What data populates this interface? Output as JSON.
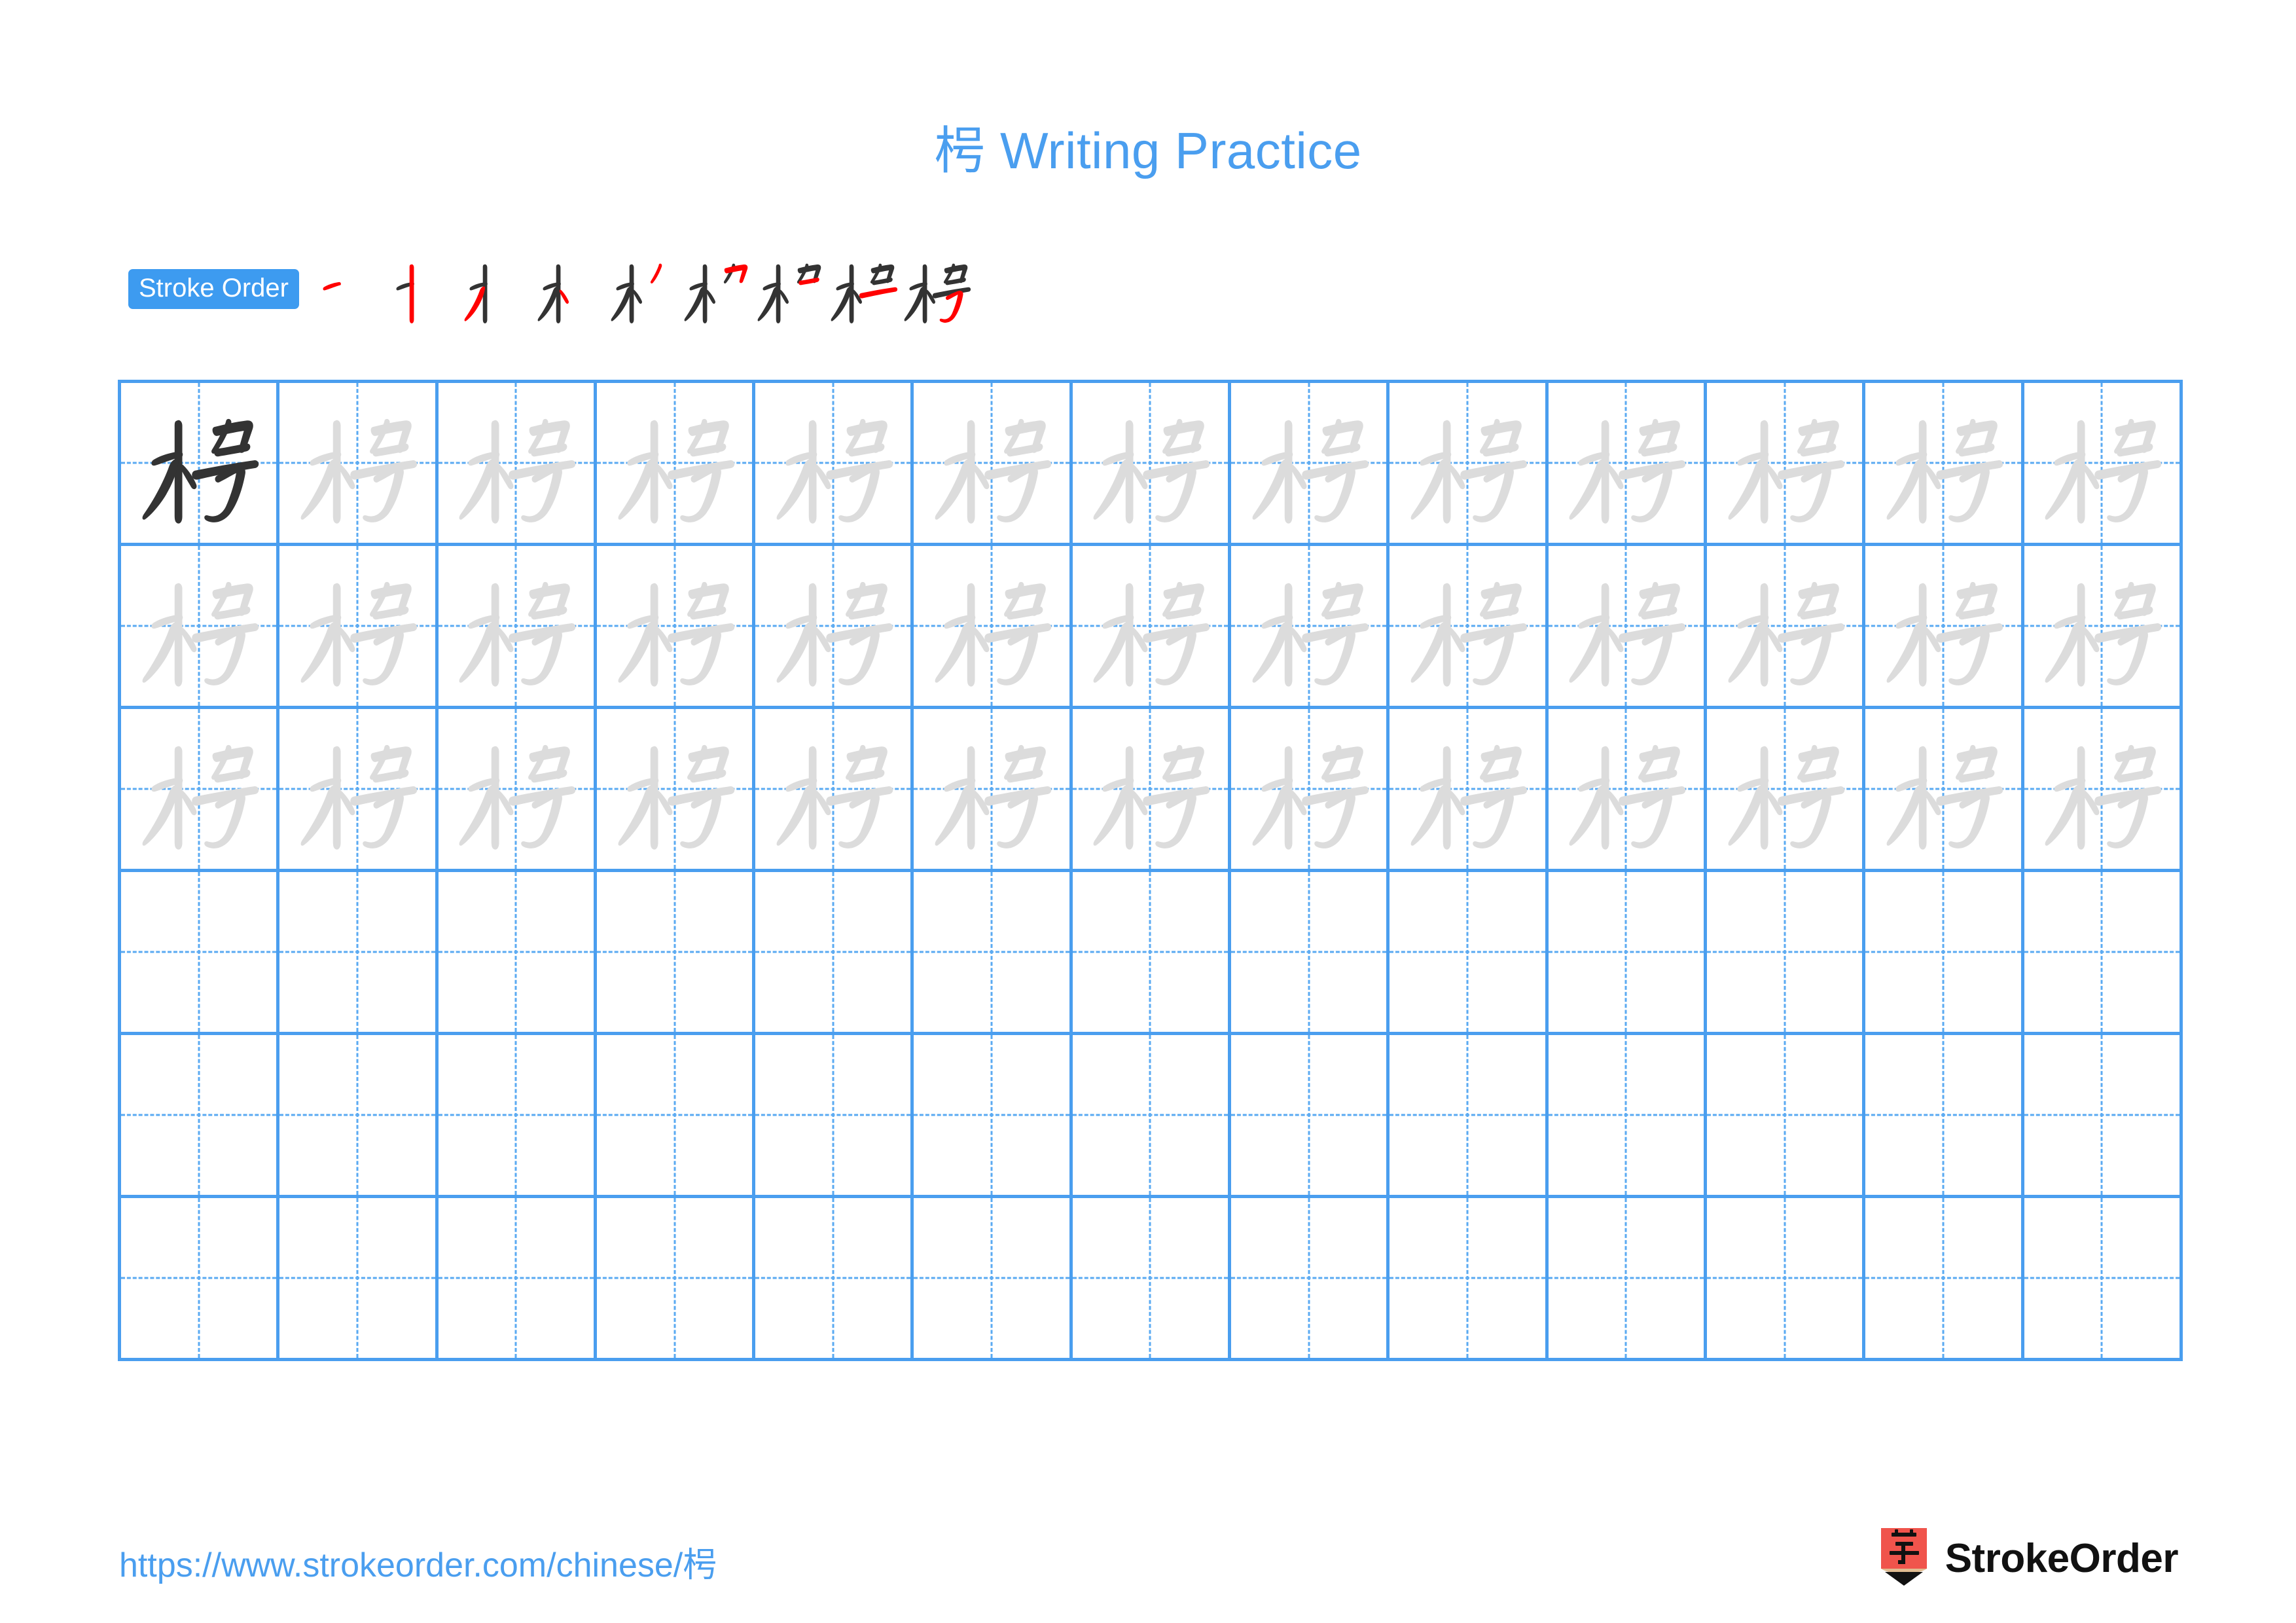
{
  "page": {
    "character": "枵",
    "title": "枵 Writing Practice",
    "background_color": "#ffffff"
  },
  "colors": {
    "accent_blue": "#4a9eef",
    "badge_blue": "#3d9bf0",
    "grid_line": "#4a9eef",
    "grid_guide": "#5aaaf2",
    "stroke_done": "#333333",
    "stroke_new": "#ff0000",
    "trace_gray": "#dcdcdc",
    "logo_red": "#f0544c",
    "logo_wood": "#e0bc91"
  },
  "stroke_order": {
    "badge_label": "Stroke Order",
    "total_strokes": 9,
    "steps": [
      {
        "index": 1,
        "name": "heng"
      },
      {
        "index": 2,
        "name": "shu"
      },
      {
        "index": 3,
        "name": "pie"
      },
      {
        "index": 4,
        "name": "dian"
      },
      {
        "index": 5,
        "name": "pie-short"
      },
      {
        "index": 6,
        "name": "heng-zhe"
      },
      {
        "index": 7,
        "name": "heng"
      },
      {
        "index": 8,
        "name": "heng-long"
      },
      {
        "index": 9,
        "name": "shu-zhe-wan-gou"
      }
    ]
  },
  "grid": {
    "columns": 13,
    "rows": 6,
    "filled_rows": 3,
    "empty_rows": 3,
    "model_cell": {
      "row": 1,
      "column": 1,
      "style": "dark"
    },
    "trace_style": "light"
  },
  "footer": {
    "url": "https://www.strokeorder.com/chinese/枵",
    "brand_name": "StrokeOrder",
    "logo_character": "字",
    "logo_icon": "pencil-icon"
  }
}
